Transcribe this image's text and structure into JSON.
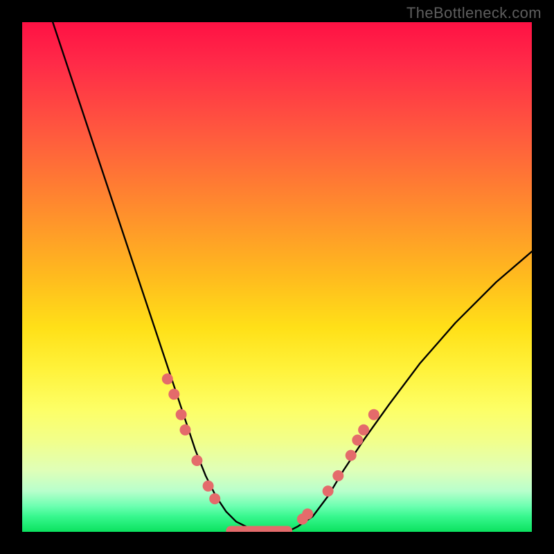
{
  "attribution": "TheBottleneck.com",
  "chart_data": {
    "type": "line",
    "title": "",
    "xlabel": "",
    "ylabel": "",
    "xlim": [
      0,
      100
    ],
    "ylim": [
      0,
      100
    ],
    "series": [
      {
        "name": "bottleneck-curve",
        "x": [
          6,
          10,
          14,
          18,
          22,
          26,
          28,
          30,
          32,
          34,
          36,
          38,
          40,
          42,
          44,
          46,
          48,
          50,
          52,
          54,
          57,
          60,
          63,
          67,
          72,
          78,
          85,
          93,
          100
        ],
        "y": [
          100,
          88,
          76,
          64,
          52,
          40,
          34,
          28,
          22,
          16,
          11,
          7,
          4,
          2,
          1,
          0,
          0,
          0,
          0,
          1,
          3,
          7,
          12,
          18,
          25,
          33,
          41,
          49,
          55
        ]
      }
    ],
    "markers": [
      {
        "name": "left-dot-1",
        "x": 28.5,
        "y": 30
      },
      {
        "name": "left-dot-2",
        "x": 29.8,
        "y": 27
      },
      {
        "name": "left-dot-3",
        "x": 31.2,
        "y": 23
      },
      {
        "name": "left-dot-4",
        "x": 32.0,
        "y": 20
      },
      {
        "name": "left-dot-5",
        "x": 34.3,
        "y": 14
      },
      {
        "name": "left-dot-6",
        "x": 36.5,
        "y": 9
      },
      {
        "name": "left-dot-7",
        "x": 37.8,
        "y": 6.5
      },
      {
        "name": "right-dot-1",
        "x": 55.0,
        "y": 2.5
      },
      {
        "name": "right-dot-2",
        "x": 56.0,
        "y": 3.5
      },
      {
        "name": "right-dot-3",
        "x": 60.0,
        "y": 8
      },
      {
        "name": "right-dot-4",
        "x": 62.0,
        "y": 11
      },
      {
        "name": "right-dot-5",
        "x": 64.5,
        "y": 15
      },
      {
        "name": "right-dot-6",
        "x": 65.8,
        "y": 18
      },
      {
        "name": "right-dot-7",
        "x": 67.0,
        "y": 20
      },
      {
        "name": "right-dot-8",
        "x": 69.0,
        "y": 23
      }
    ],
    "flat_segment": {
      "x_start": 40,
      "x_end": 53,
      "y": 0.2
    }
  }
}
